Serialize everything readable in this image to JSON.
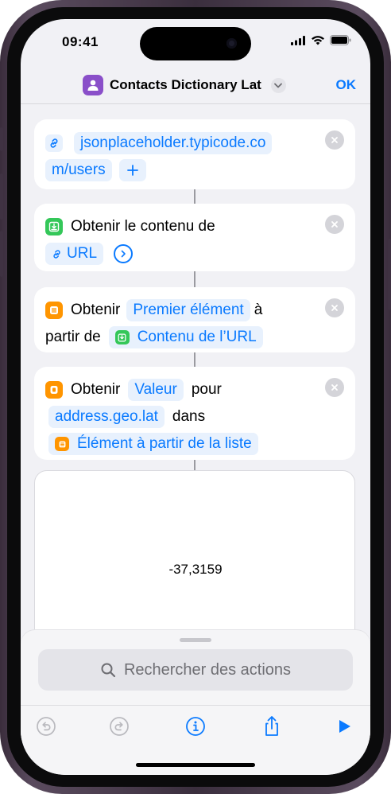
{
  "status": {
    "time": "09:41"
  },
  "nav": {
    "title": "Contacts Dictionary Lat",
    "done_label": "OK"
  },
  "actions": {
    "url_card": {
      "line1": "jsonplaceholder.typicode.co",
      "line2": "m/users"
    },
    "get_contents": {
      "text": "Obtenir le contenu de",
      "token": "URL"
    },
    "get_item": {
      "word1": "Obtenir",
      "token1": "Premier élément",
      "word2": "à",
      "word3": "partir de",
      "token2": "Contenu de l’URL"
    },
    "get_value": {
      "word1": "Obtenir",
      "token1": "Valeur",
      "word2": "pour",
      "token2": "address.geo.lat",
      "word3": "dans",
      "token3": "Élément à partir de la liste"
    }
  },
  "result": {
    "value": "-37,3159"
  },
  "sheet": {
    "search_placeholder": "Rechercher des actions"
  },
  "colors": {
    "accent": "#0a7aff",
    "app_icon": "#8a4fc9",
    "green_action": "#34c759",
    "orange_action": "#ff9500"
  },
  "icons": [
    "link-icon",
    "download-icon",
    "list-icon",
    "dictionary-icon",
    "close-icon",
    "chevron-down-icon",
    "plus-icon",
    "arrow-right-circle-icon",
    "search-icon",
    "undo-icon",
    "redo-icon",
    "info-icon",
    "share-icon",
    "play-icon"
  ]
}
